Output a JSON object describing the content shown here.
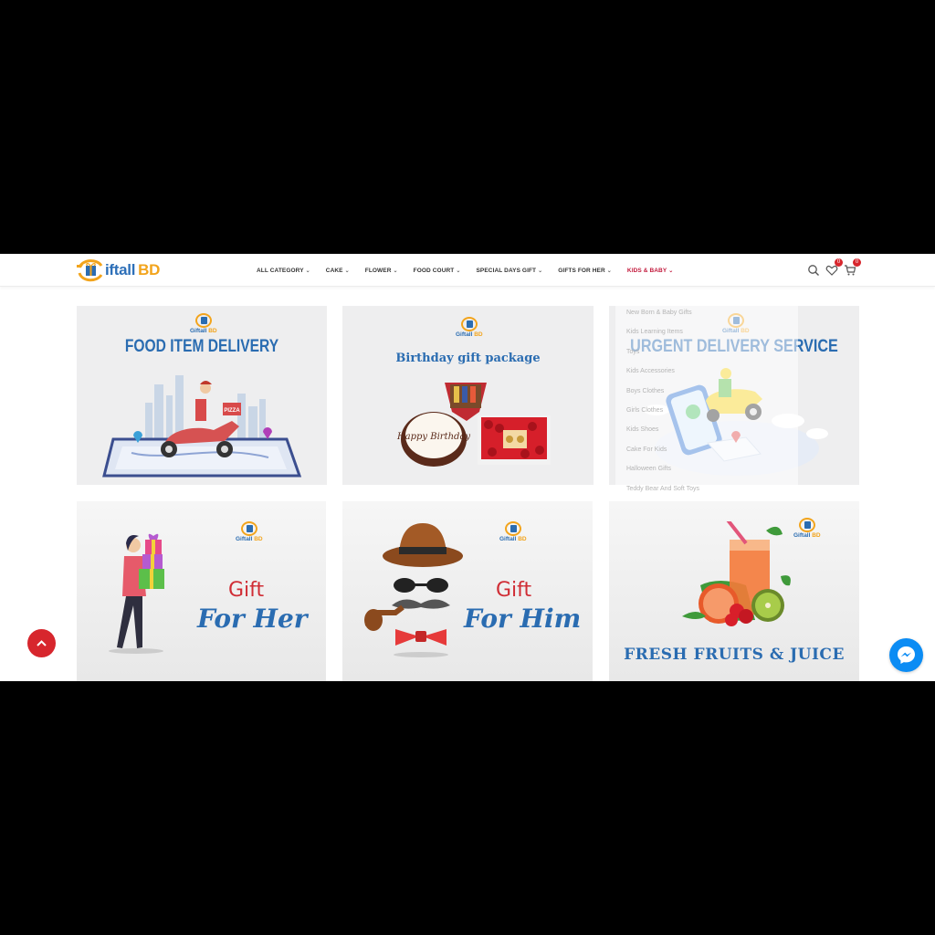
{
  "brand": {
    "logo_g": "G",
    "logo_rest": "iftall",
    "logo_bd": "BD",
    "mini_g": "Giftall",
    "mini_bd": "BD"
  },
  "nav": [
    {
      "label": "ALL CATEGORY",
      "active": false
    },
    {
      "label": "CAKE",
      "active": false
    },
    {
      "label": "FLOWER",
      "active": false
    },
    {
      "label": "FOOD COURT",
      "active": false
    },
    {
      "label": "SPECIAL DAYS GIFT",
      "active": false
    },
    {
      "label": "GIFTS FOR HER",
      "active": false
    },
    {
      "label": "KIDS & BABY",
      "active": true
    }
  ],
  "header_icons": {
    "search": "search-icon",
    "wishlist": "heart-icon",
    "wishlist_count": "0",
    "cart": "cart-icon",
    "cart_count": "0"
  },
  "tiles": {
    "food": {
      "title": "FOOD ITEM DELIVERY",
      "sign": "PIZZA"
    },
    "birthday": {
      "title": "Birthday gift package",
      "cake_text": "Happy Birthday"
    },
    "urgent": {
      "title": "URGENT DELIVERY SERVICE"
    },
    "her": {
      "gift": "Gift",
      "for": "For Her"
    },
    "him": {
      "gift": "Gift",
      "for": "For Him"
    },
    "fruits": {
      "title": "FRESH FRUITS & JUICE"
    }
  },
  "dropdown": [
    "New Born & Baby Gifts",
    "Kids Learning Items",
    "Toys",
    "Kids Accessories",
    "Boys Clothes",
    "Girls Clothes",
    "Kids Shoes",
    "Cake For Kids",
    "Halloween Gifts",
    "Teddy Bear And Soft Toys"
  ],
  "colors": {
    "accent_red": "#d7262d",
    "brand_blue": "#2a6cb1",
    "brand_orange": "#f2a41c",
    "messenger": "#0b8cf4"
  }
}
